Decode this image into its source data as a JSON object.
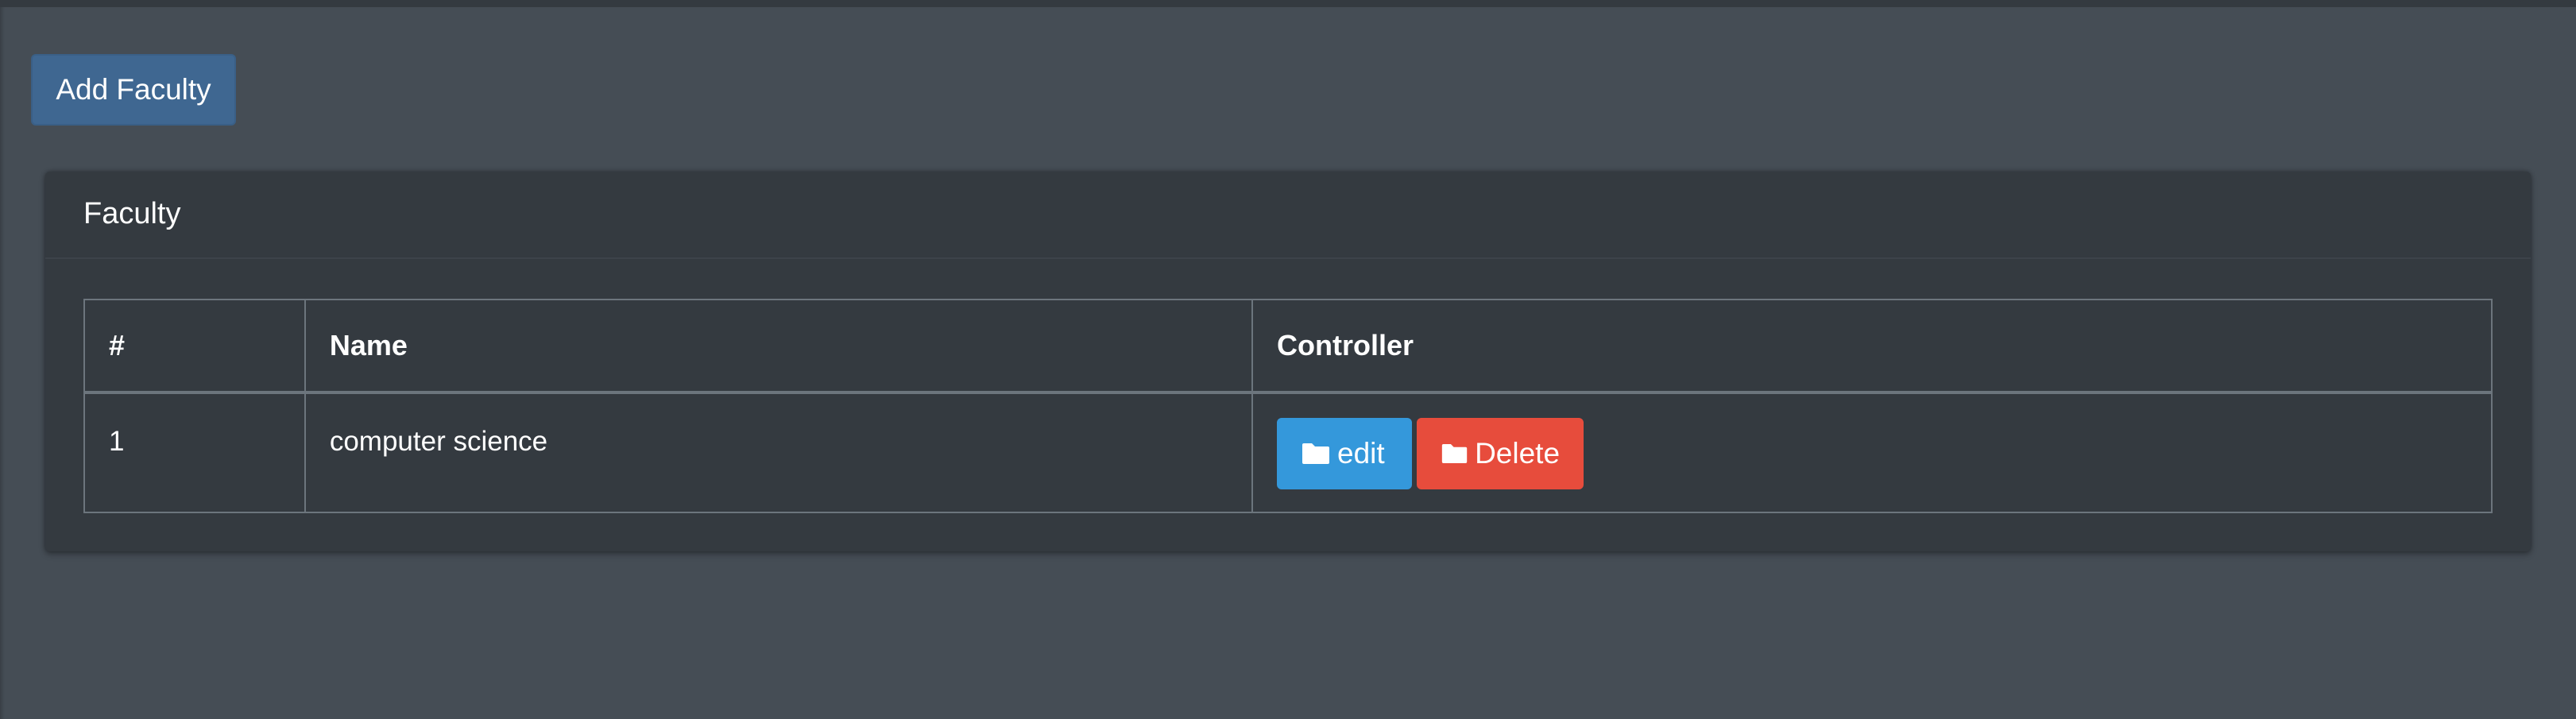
{
  "toolbar": {
    "add_label": "Add Faculty"
  },
  "card": {
    "title": "Faculty"
  },
  "table": {
    "headers": [
      "#",
      "Name",
      "Controller"
    ],
    "rows": [
      {
        "num": "1",
        "name": "computer science",
        "actions": {
          "edit_label": "edit",
          "delete_label": "Delete"
        }
      }
    ]
  },
  "icons": {
    "edit": "folder-icon",
    "delete": "folder-icon"
  },
  "colors": {
    "background": "#454d55",
    "card": "#343a40",
    "add_button": "#3f6791",
    "edit_button": "#3498db",
    "delete_button": "#e74c3c"
  }
}
